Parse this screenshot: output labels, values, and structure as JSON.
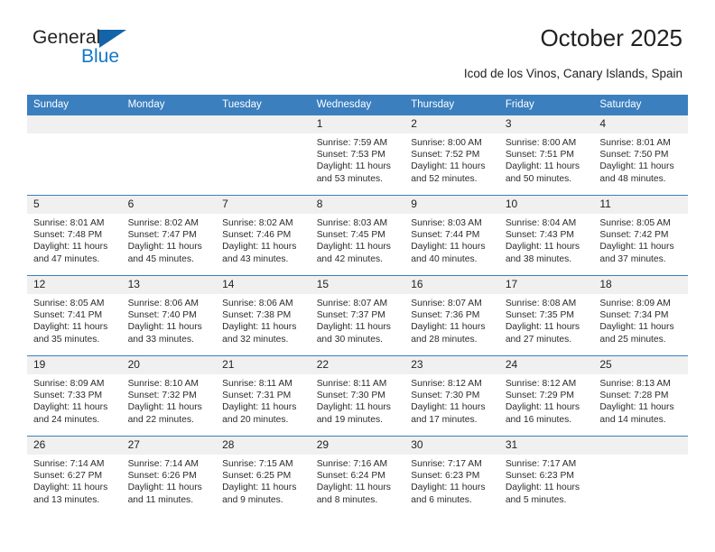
{
  "brand": {
    "name_part1": "General",
    "name_part2": "Blue",
    "triangle_color": "#1464aa",
    "blue_color": "#1478c8"
  },
  "header": {
    "title": "October 2025",
    "subtitle": "Icod de los Vinos, Canary Islands, Spain",
    "header_bg_color": "#3b7fbf",
    "daynum_bg_color": "#f0f0f0"
  },
  "weekdays": [
    "Sunday",
    "Monday",
    "Tuesday",
    "Wednesday",
    "Thursday",
    "Friday",
    "Saturday"
  ],
  "weeks": [
    [
      {
        "day": "",
        "sunrise": "",
        "sunset": "",
        "daylight_line1": "",
        "daylight_line2": ""
      },
      {
        "day": "",
        "sunrise": "",
        "sunset": "",
        "daylight_line1": "",
        "daylight_line2": ""
      },
      {
        "day": "",
        "sunrise": "",
        "sunset": "",
        "daylight_line1": "",
        "daylight_line2": ""
      },
      {
        "day": "1",
        "sunrise": "Sunrise: 7:59 AM",
        "sunset": "Sunset: 7:53 PM",
        "daylight_line1": "Daylight: 11 hours",
        "daylight_line2": "and 53 minutes."
      },
      {
        "day": "2",
        "sunrise": "Sunrise: 8:00 AM",
        "sunset": "Sunset: 7:52 PM",
        "daylight_line1": "Daylight: 11 hours",
        "daylight_line2": "and 52 minutes."
      },
      {
        "day": "3",
        "sunrise": "Sunrise: 8:00 AM",
        "sunset": "Sunset: 7:51 PM",
        "daylight_line1": "Daylight: 11 hours",
        "daylight_line2": "and 50 minutes."
      },
      {
        "day": "4",
        "sunrise": "Sunrise: 8:01 AM",
        "sunset": "Sunset: 7:50 PM",
        "daylight_line1": "Daylight: 11 hours",
        "daylight_line2": "and 48 minutes."
      }
    ],
    [
      {
        "day": "5",
        "sunrise": "Sunrise: 8:01 AM",
        "sunset": "Sunset: 7:48 PM",
        "daylight_line1": "Daylight: 11 hours",
        "daylight_line2": "and 47 minutes."
      },
      {
        "day": "6",
        "sunrise": "Sunrise: 8:02 AM",
        "sunset": "Sunset: 7:47 PM",
        "daylight_line1": "Daylight: 11 hours",
        "daylight_line2": "and 45 minutes."
      },
      {
        "day": "7",
        "sunrise": "Sunrise: 8:02 AM",
        "sunset": "Sunset: 7:46 PM",
        "daylight_line1": "Daylight: 11 hours",
        "daylight_line2": "and 43 minutes."
      },
      {
        "day": "8",
        "sunrise": "Sunrise: 8:03 AM",
        "sunset": "Sunset: 7:45 PM",
        "daylight_line1": "Daylight: 11 hours",
        "daylight_line2": "and 42 minutes."
      },
      {
        "day": "9",
        "sunrise": "Sunrise: 8:03 AM",
        "sunset": "Sunset: 7:44 PM",
        "daylight_line1": "Daylight: 11 hours",
        "daylight_line2": "and 40 minutes."
      },
      {
        "day": "10",
        "sunrise": "Sunrise: 8:04 AM",
        "sunset": "Sunset: 7:43 PM",
        "daylight_line1": "Daylight: 11 hours",
        "daylight_line2": "and 38 minutes."
      },
      {
        "day": "11",
        "sunrise": "Sunrise: 8:05 AM",
        "sunset": "Sunset: 7:42 PM",
        "daylight_line1": "Daylight: 11 hours",
        "daylight_line2": "and 37 minutes."
      }
    ],
    [
      {
        "day": "12",
        "sunrise": "Sunrise: 8:05 AM",
        "sunset": "Sunset: 7:41 PM",
        "daylight_line1": "Daylight: 11 hours",
        "daylight_line2": "and 35 minutes."
      },
      {
        "day": "13",
        "sunrise": "Sunrise: 8:06 AM",
        "sunset": "Sunset: 7:40 PM",
        "daylight_line1": "Daylight: 11 hours",
        "daylight_line2": "and 33 minutes."
      },
      {
        "day": "14",
        "sunrise": "Sunrise: 8:06 AM",
        "sunset": "Sunset: 7:38 PM",
        "daylight_line1": "Daylight: 11 hours",
        "daylight_line2": "and 32 minutes."
      },
      {
        "day": "15",
        "sunrise": "Sunrise: 8:07 AM",
        "sunset": "Sunset: 7:37 PM",
        "daylight_line1": "Daylight: 11 hours",
        "daylight_line2": "and 30 minutes."
      },
      {
        "day": "16",
        "sunrise": "Sunrise: 8:07 AM",
        "sunset": "Sunset: 7:36 PM",
        "daylight_line1": "Daylight: 11 hours",
        "daylight_line2": "and 28 minutes."
      },
      {
        "day": "17",
        "sunrise": "Sunrise: 8:08 AM",
        "sunset": "Sunset: 7:35 PM",
        "daylight_line1": "Daylight: 11 hours",
        "daylight_line2": "and 27 minutes."
      },
      {
        "day": "18",
        "sunrise": "Sunrise: 8:09 AM",
        "sunset": "Sunset: 7:34 PM",
        "daylight_line1": "Daylight: 11 hours",
        "daylight_line2": "and 25 minutes."
      }
    ],
    [
      {
        "day": "19",
        "sunrise": "Sunrise: 8:09 AM",
        "sunset": "Sunset: 7:33 PM",
        "daylight_line1": "Daylight: 11 hours",
        "daylight_line2": "and 24 minutes."
      },
      {
        "day": "20",
        "sunrise": "Sunrise: 8:10 AM",
        "sunset": "Sunset: 7:32 PM",
        "daylight_line1": "Daylight: 11 hours",
        "daylight_line2": "and 22 minutes."
      },
      {
        "day": "21",
        "sunrise": "Sunrise: 8:11 AM",
        "sunset": "Sunset: 7:31 PM",
        "daylight_line1": "Daylight: 11 hours",
        "daylight_line2": "and 20 minutes."
      },
      {
        "day": "22",
        "sunrise": "Sunrise: 8:11 AM",
        "sunset": "Sunset: 7:30 PM",
        "daylight_line1": "Daylight: 11 hours",
        "daylight_line2": "and 19 minutes."
      },
      {
        "day": "23",
        "sunrise": "Sunrise: 8:12 AM",
        "sunset": "Sunset: 7:30 PM",
        "daylight_line1": "Daylight: 11 hours",
        "daylight_line2": "and 17 minutes."
      },
      {
        "day": "24",
        "sunrise": "Sunrise: 8:12 AM",
        "sunset": "Sunset: 7:29 PM",
        "daylight_line1": "Daylight: 11 hours",
        "daylight_line2": "and 16 minutes."
      },
      {
        "day": "25",
        "sunrise": "Sunrise: 8:13 AM",
        "sunset": "Sunset: 7:28 PM",
        "daylight_line1": "Daylight: 11 hours",
        "daylight_line2": "and 14 minutes."
      }
    ],
    [
      {
        "day": "26",
        "sunrise": "Sunrise: 7:14 AM",
        "sunset": "Sunset: 6:27 PM",
        "daylight_line1": "Daylight: 11 hours",
        "daylight_line2": "and 13 minutes."
      },
      {
        "day": "27",
        "sunrise": "Sunrise: 7:14 AM",
        "sunset": "Sunset: 6:26 PM",
        "daylight_line1": "Daylight: 11 hours",
        "daylight_line2": "and 11 minutes."
      },
      {
        "day": "28",
        "sunrise": "Sunrise: 7:15 AM",
        "sunset": "Sunset: 6:25 PM",
        "daylight_line1": "Daylight: 11 hours",
        "daylight_line2": "and 9 minutes."
      },
      {
        "day": "29",
        "sunrise": "Sunrise: 7:16 AM",
        "sunset": "Sunset: 6:24 PM",
        "daylight_line1": "Daylight: 11 hours",
        "daylight_line2": "and 8 minutes."
      },
      {
        "day": "30",
        "sunrise": "Sunrise: 7:17 AM",
        "sunset": "Sunset: 6:23 PM",
        "daylight_line1": "Daylight: 11 hours",
        "daylight_line2": "and 6 minutes."
      },
      {
        "day": "31",
        "sunrise": "Sunrise: 7:17 AM",
        "sunset": "Sunset: 6:23 PM",
        "daylight_line1": "Daylight: 11 hours",
        "daylight_line2": "and 5 minutes."
      },
      {
        "day": "",
        "sunrise": "",
        "sunset": "",
        "daylight_line1": "",
        "daylight_line2": ""
      }
    ]
  ]
}
